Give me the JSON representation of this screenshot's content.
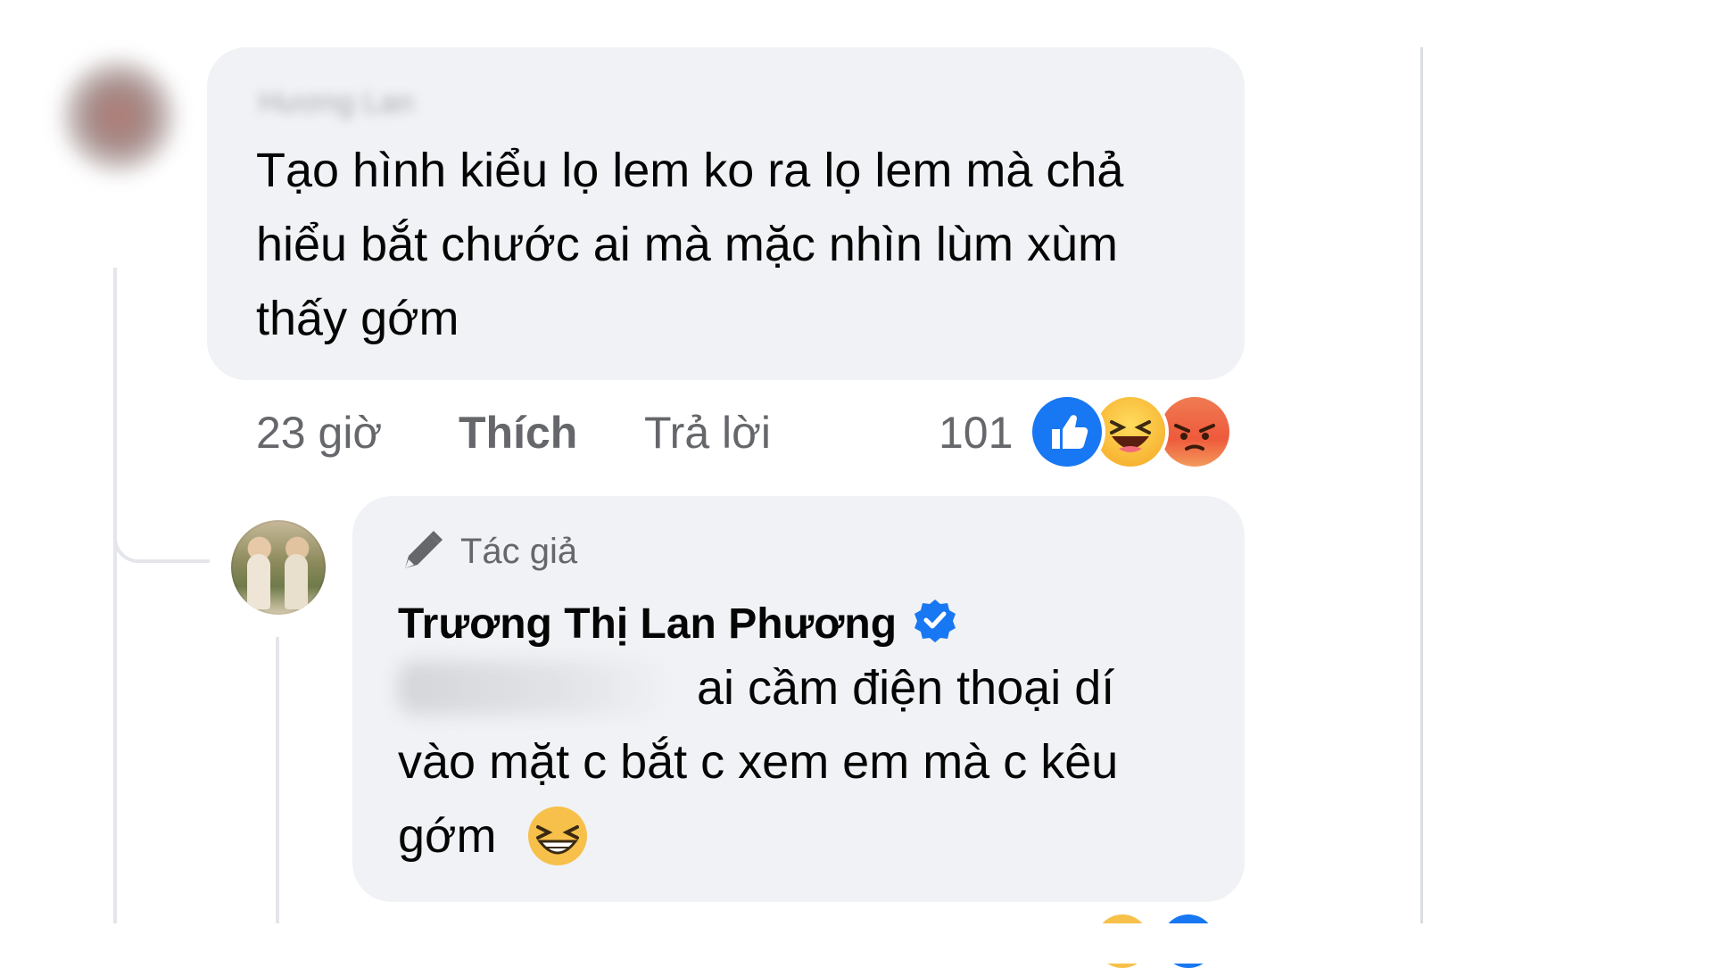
{
  "comment": {
    "author_name_blurred": "Hương Lan",
    "text": "Tạo hình kiểu lọ lem ko ra lọ lem mà chả hiểu bắt chước ai mà mặc nhìn lùm xùm thấy gớm",
    "time": "23 giờ",
    "like_label": "Thích",
    "reply_label": "Trả lời",
    "reaction_count": "101",
    "reactions": [
      "like-icon",
      "haha-icon",
      "angry-icon"
    ]
  },
  "reply": {
    "badge_icon": "pen-icon",
    "badge_label": "Tác giả",
    "author_name": "Trương Thị Lan Phương",
    "verified_icon": "verified-badge-icon",
    "mention_blurred": "H",
    "text": "ai cầm điện thoại dí vào mặt c bắt c xem em mà c kêu gớm",
    "emoji": "laughing-emoji"
  },
  "colors": {
    "bubble": "#f0f2f5",
    "secondary_text": "#65676b",
    "primary_text": "#050505",
    "like_blue": "#1877f2",
    "thread_line": "#e4e6eb"
  }
}
